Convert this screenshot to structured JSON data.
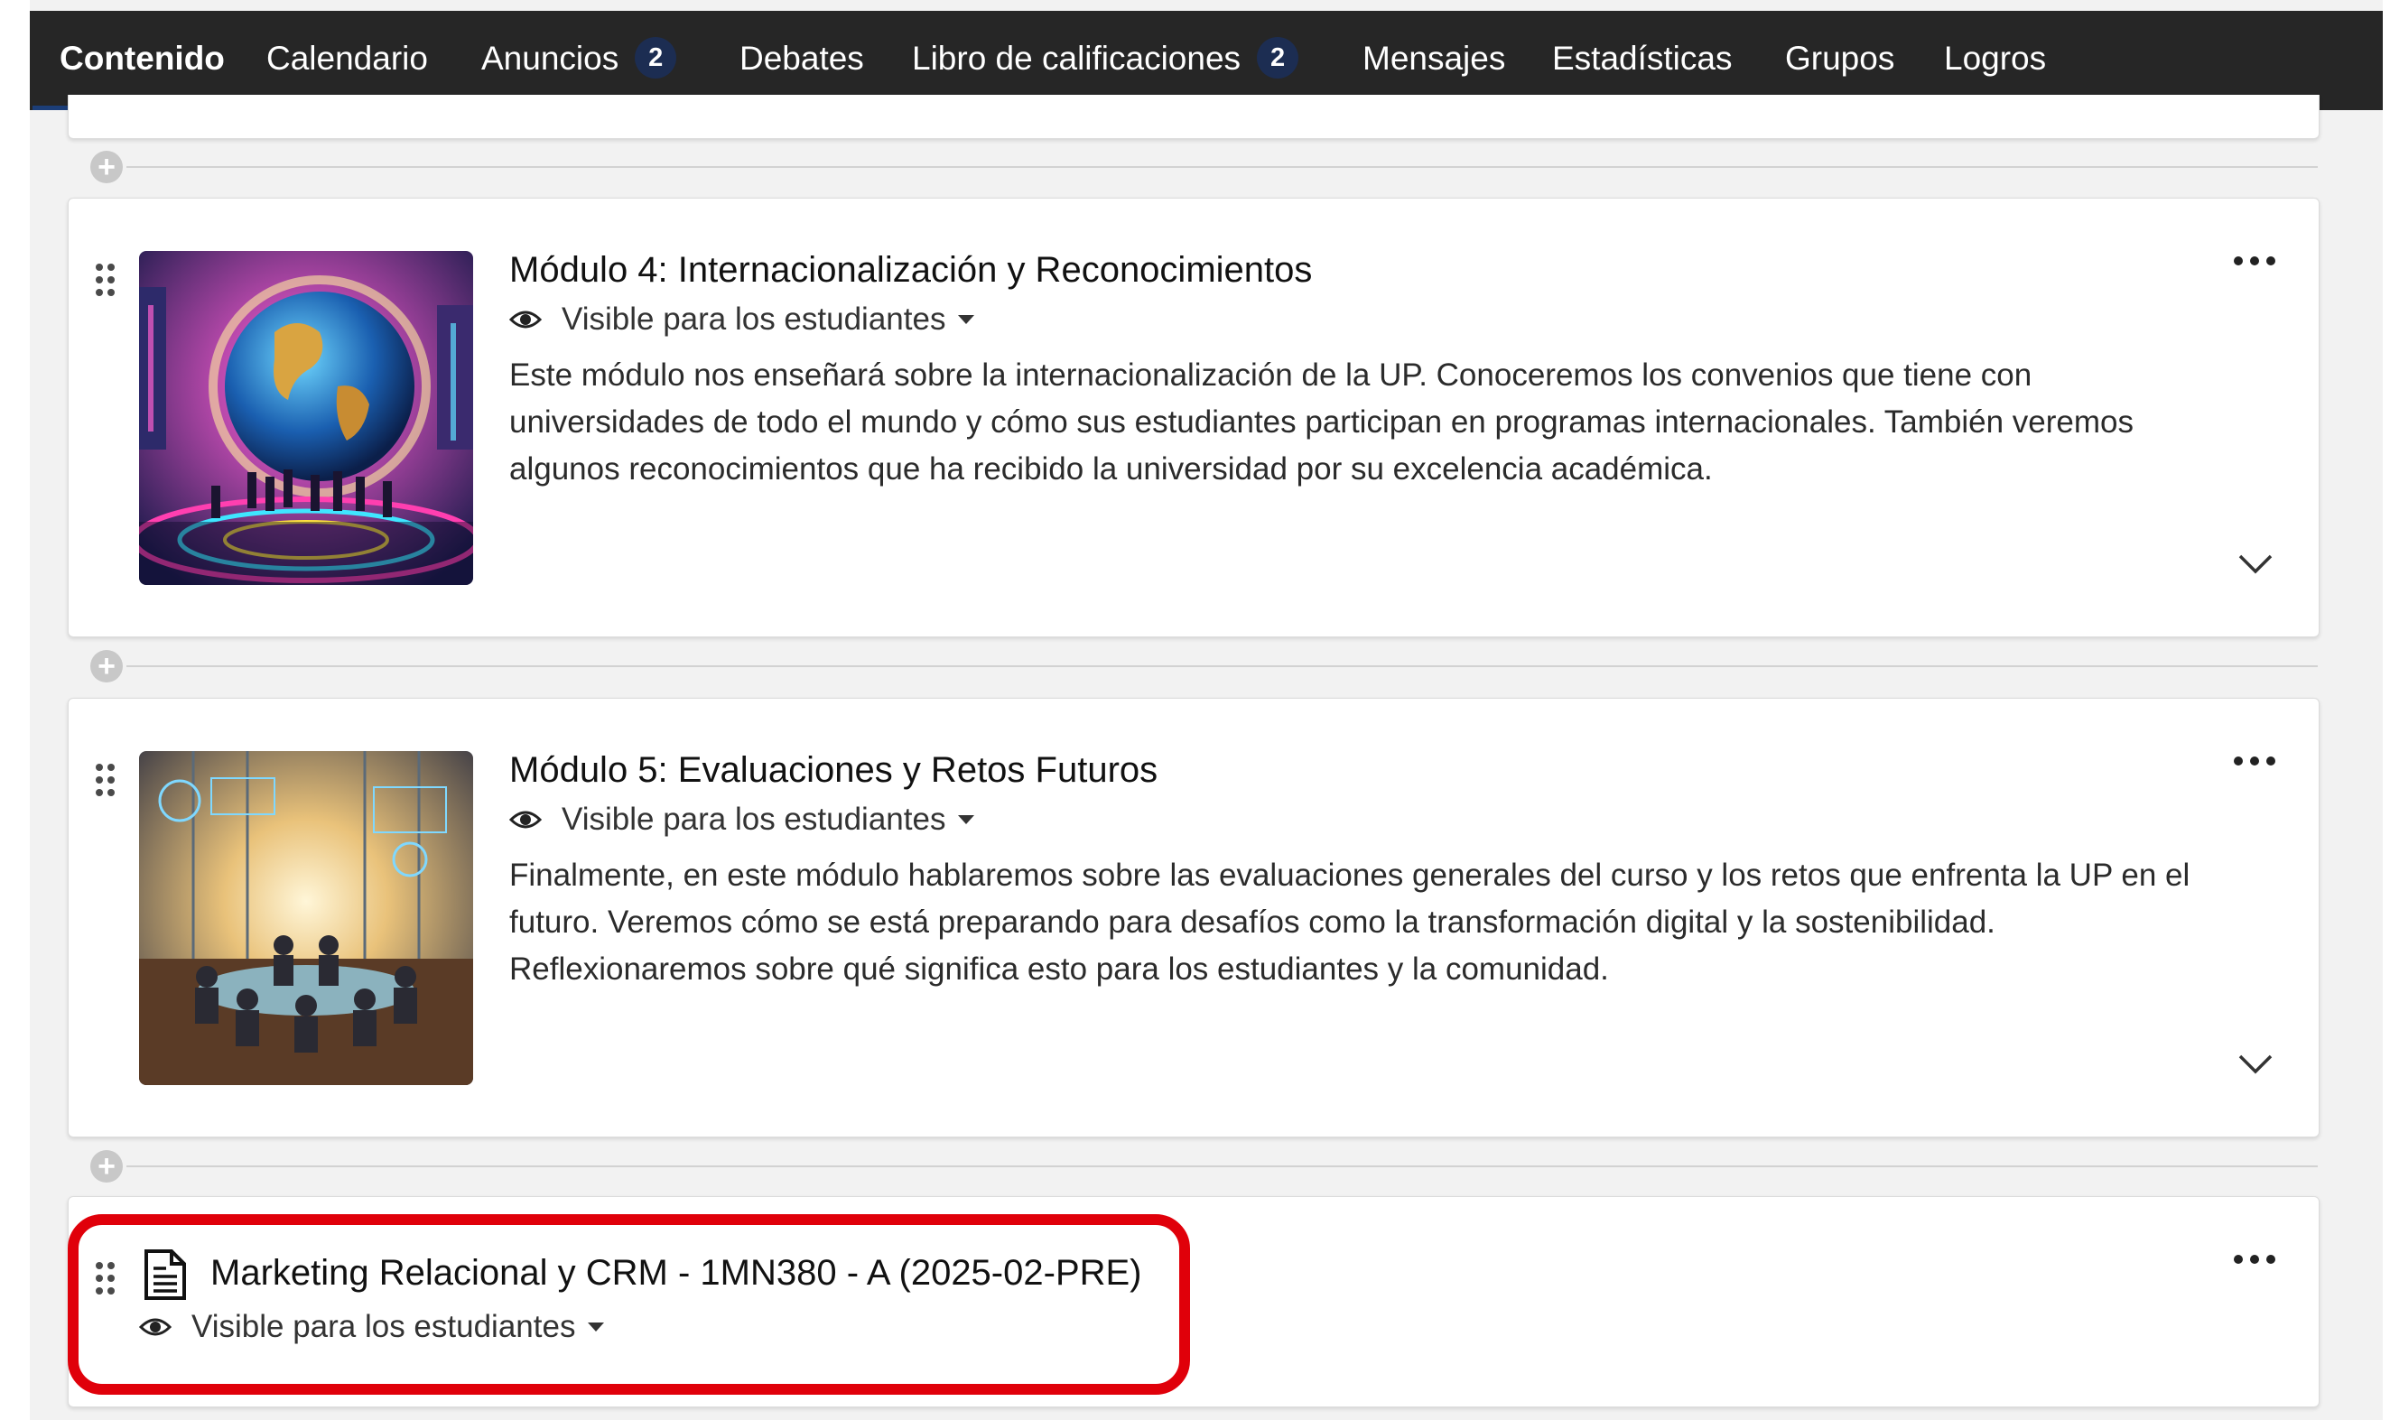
{
  "nav": {
    "tabs": [
      {
        "label": "Contenido",
        "active": true
      },
      {
        "label": "Calendario"
      },
      {
        "label": "Anuncios",
        "badge": "2"
      },
      {
        "label": "Debates"
      },
      {
        "label": "Libro de calificaciones",
        "badge": "2"
      },
      {
        "label": "Mensajes"
      },
      {
        "label": "Estadísticas"
      },
      {
        "label": "Grupos"
      },
      {
        "label": "Logros"
      }
    ]
  },
  "modules": [
    {
      "title": "Módulo 4: Internacionalización y Reconocimientos",
      "visibility": "Visible para los estudiantes",
      "description": "Este módulo nos enseñará sobre la internacionalización de la UP. Conoceremos los convenios que tiene con universidades de todo el mundo y cómo sus estudiantes participan en programas internacionales. También veremos algunos reconocimientos que ha recibido la universidad por su excelencia académica."
    },
    {
      "title": "Módulo 5: Evaluaciones y Retos Futuros",
      "visibility": "Visible para los estudiantes",
      "description": "Finalmente, en este módulo hablaremos sobre las evaluaciones generales del curso y los retos que enfrenta la UP en el futuro. Veremos cómo se está preparando para desafíos como la transformación digital y la sostenibilidad. Reflexionaremos sobre qué significa esto para los estudiantes y la comunidad."
    }
  ],
  "document_item": {
    "title": "Marketing Relacional y CRM - 1MN380 - A (2025-02-PRE)",
    "visibility": "Visible para los estudiantes"
  },
  "colors": {
    "navbar": "#262626",
    "badge": "#1c2d52",
    "highlight": "#e0000a",
    "page_bg": "#f2f2f2"
  },
  "icons": [
    "plus-icon",
    "drag-handle-icon",
    "eye-icon",
    "caret-down-icon",
    "more-options-icon",
    "chevron-down-icon",
    "document-icon"
  ]
}
